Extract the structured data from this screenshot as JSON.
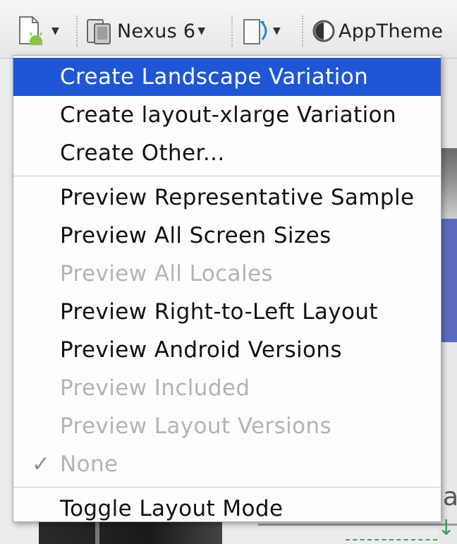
{
  "toolbar": {
    "device_label": "Nexus 6",
    "theme_label": "AppTheme",
    "accent_green": "#3ddc84"
  },
  "menu": {
    "sections": [
      [
        {
          "label": "Create Landscape Variation",
          "selected": true,
          "enabled": true
        },
        {
          "label": "Create layout-xlarge Variation",
          "selected": false,
          "enabled": true
        },
        {
          "label": "Create Other...",
          "selected": false,
          "enabled": true
        }
      ],
      [
        {
          "label": "Preview Representative Sample",
          "enabled": true
        },
        {
          "label": "Preview All Screen Sizes",
          "enabled": true
        },
        {
          "label": "Preview All Locales",
          "enabled": false
        },
        {
          "label": "Preview Right-to-Left Layout",
          "enabled": true
        },
        {
          "label": "Preview Android Versions",
          "enabled": true
        },
        {
          "label": "Preview Included",
          "enabled": false
        },
        {
          "label": "Preview Layout Versions",
          "enabled": false
        },
        {
          "label": "None",
          "enabled": false,
          "checked": true,
          "check_glyph": "✓"
        }
      ],
      [
        {
          "label": "Toggle Layout Mode",
          "enabled": true
        }
      ]
    ]
  },
  "colors": {
    "selection": "#1e56d6",
    "disabled_text": "#b3b3b3"
  }
}
